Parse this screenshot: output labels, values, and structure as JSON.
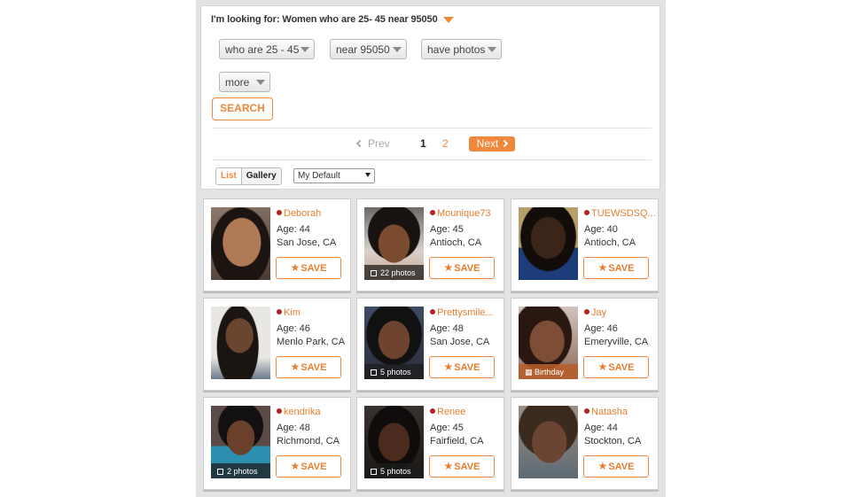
{
  "search": {
    "looking_for": "I'm looking for: Women who are 25- 45 near 95050",
    "filters": [
      "who are 25 - 45",
      "near 95050",
      "have photos"
    ],
    "more_label": "more",
    "search_button": "SEARCH"
  },
  "pagination": {
    "prev": "Prev",
    "pages": [
      "1",
      "2"
    ],
    "current": "1",
    "next": "Next"
  },
  "view": {
    "list": "List",
    "gallery": "Gallery",
    "active": "List",
    "sort": "My Default"
  },
  "save_label": "SAVE",
  "profiles": [
    {
      "name": "Deborah",
      "age": "Age: 44",
      "city": "San Jose, CA",
      "badge": ""
    },
    {
      "name": "Mounique73",
      "age": "Age: 45",
      "city": "Antioch, CA",
      "badge": "22 photos"
    },
    {
      "name": "TUEWSDSQ...",
      "age": "Age: 40",
      "city": "Antioch, CA",
      "badge": ""
    },
    {
      "name": "Kim",
      "age": "Age: 46",
      "city": "Menlo Park, CA",
      "badge": ""
    },
    {
      "name": "Prettysmile...",
      "age": "Age: 48",
      "city": "San Jose, CA",
      "badge": "5 photos"
    },
    {
      "name": "Jay",
      "age": "Age: 46",
      "city": "Emeryville, CA",
      "badge": "Birthday"
    },
    {
      "name": "kendrika",
      "age": "Age: 48",
      "city": "Richmond, CA",
      "badge": "2 photos"
    },
    {
      "name": "Renee",
      "age": "Age: 45",
      "city": "Fairfield, CA",
      "badge": "5 photos"
    },
    {
      "name": "Natasha",
      "age": "Age: 44",
      "city": "Stockton, CA",
      "badge": ""
    }
  ],
  "colors": {
    "accent": "#f0873a",
    "online_dot": "#b3231e"
  }
}
